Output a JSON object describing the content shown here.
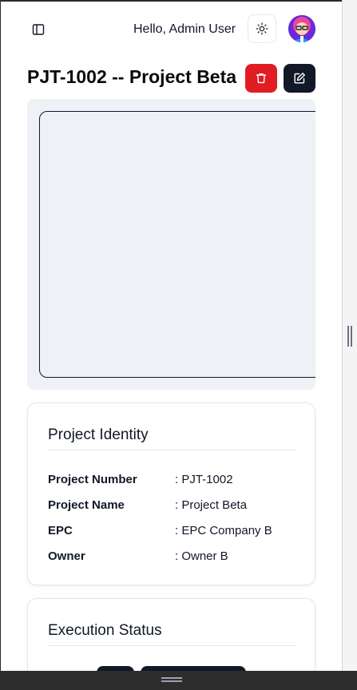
{
  "header": {
    "greeting": "Hello, Admin User",
    "icons": {
      "sidebar_toggle": "panel-left-icon",
      "theme": "sun-icon",
      "avatar": "user-avatar"
    }
  },
  "project": {
    "title": "PJT-1002 -- Project Beta",
    "actions": {
      "delete_icon": "trash-icon",
      "edit_icon": "edit-icon"
    }
  },
  "identity": {
    "title": "Project Identity",
    "rows": [
      {
        "label": "Project Number",
        "value": ": PJT-1002"
      },
      {
        "label": "Project Name",
        "value": ": Project Beta"
      },
      {
        "label": "EPC",
        "value": ": EPC Company B"
      },
      {
        "label": "Owner",
        "value": ": Owner B"
      }
    ]
  },
  "execution": {
    "title": "Execution Status"
  },
  "colors": {
    "danger": "#e11d24",
    "primary": "#111827",
    "panel_bg": "#eef1f5",
    "border": "#e5e7eb"
  }
}
